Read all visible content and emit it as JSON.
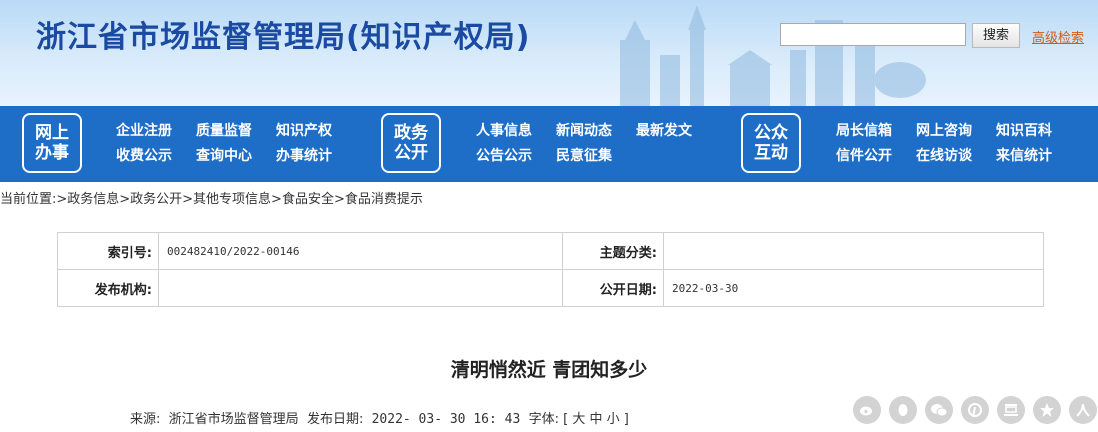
{
  "header": {
    "site_title": "浙江省市场监督管理局(知识产权局)",
    "search_placeholder": "",
    "search_button": "搜索",
    "advanced_search": "高级检索"
  },
  "nav": {
    "block1": {
      "title": "网上\n办事",
      "links": [
        "企业注册",
        "质量监督",
        "知识产权",
        "收费公示",
        "查询中心",
        "办事统计"
      ]
    },
    "block2": {
      "title": "政务\n公开",
      "links": [
        "人事信息",
        "新闻动态",
        "最新发文",
        "公告公示",
        "民意征集"
      ]
    },
    "block3": {
      "title": "公众\n互动",
      "links": [
        "局长信箱",
        "网上咨询",
        "知识百科",
        "信件公开",
        "在线访谈",
        "来信统计"
      ]
    }
  },
  "breadcrumb": "当前位置:>政务信息>政务公开>其他专项信息>食品安全>食品消费提示",
  "info": {
    "index_label": "索引号:",
    "index_value": "002482410/2022-00146",
    "topic_label": "主题分类:",
    "topic_value": "",
    "publisher_label": "发布机构:",
    "publisher_value": "",
    "date_label": "公开日期:",
    "date_value": "2022-03-30"
  },
  "article": {
    "title": "清明悄然近 青团知多少",
    "source_label": "来源:",
    "source_value": "浙江省市场监督管理局",
    "pubdate_label": "发布日期:",
    "pubdate_value": "2022- 03- 30 16: 43",
    "font_label": "字体:",
    "font_options": "[ 大 中 小 ]"
  },
  "share_icons": [
    "weibo-icon",
    "qq-icon",
    "wechat-icon",
    "pinterest-icon",
    "douban-icon",
    "qzone-icon",
    "renren-icon"
  ],
  "colors": {
    "nav_bg": "#1e6ec8",
    "title_blue": "#1b4aa3",
    "adv_search": "#d05a1a"
  }
}
